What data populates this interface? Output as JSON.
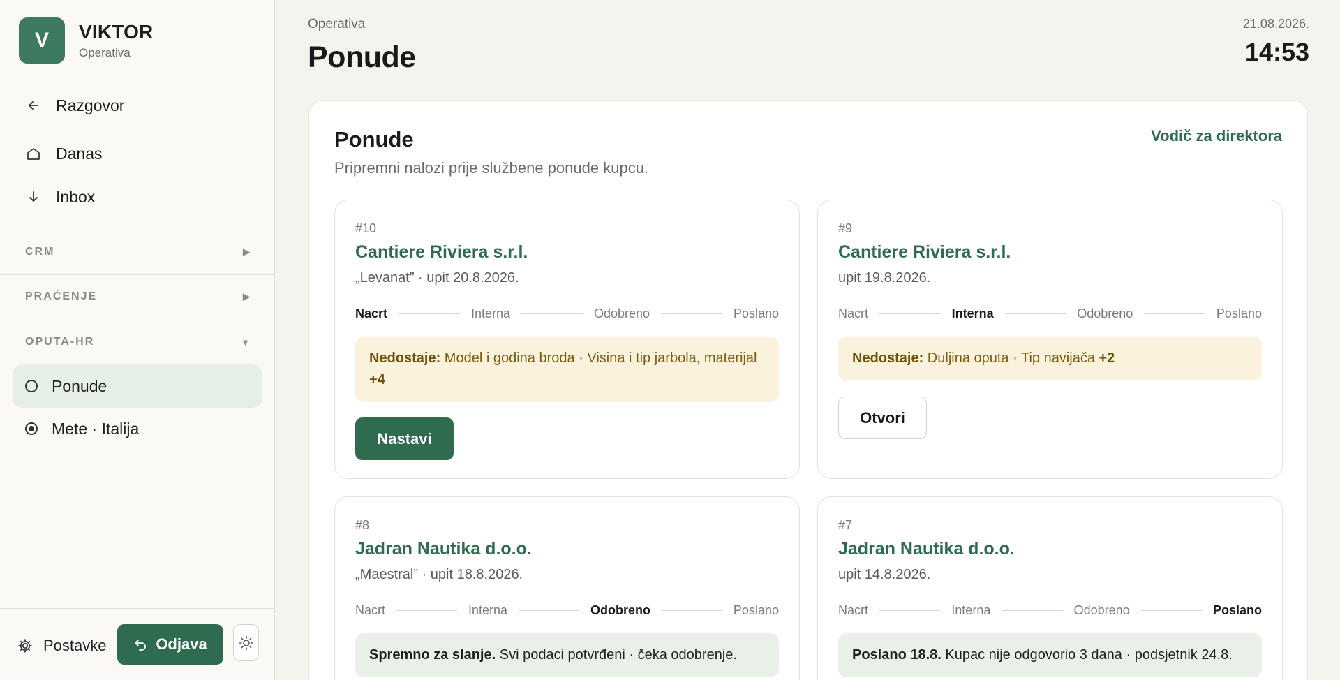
{
  "brand": {
    "initial": "V",
    "name": "VIKTOR",
    "subtitle": "Operativa"
  },
  "nav": [
    {
      "label": "Razgovor",
      "icon": "arrow-left-icon"
    },
    {
      "label": "Danas",
      "icon": "home-icon"
    },
    {
      "label": "Inbox",
      "icon": "arrow-down-icon"
    }
  ],
  "sections": [
    {
      "label": "CRM",
      "state": "collapsed",
      "arrow": "▶"
    },
    {
      "label": "PRAĆENJE",
      "state": "collapsed",
      "arrow": "▶"
    },
    {
      "label": "OPUTA-HR",
      "state": "expanded",
      "arrow": "▼"
    }
  ],
  "subnav": [
    {
      "label": "Ponude",
      "active": true
    },
    {
      "label": "Mete · Italija",
      "active": false
    }
  ],
  "footer": {
    "settings_label": "Postavke",
    "logout_label": "Odjava"
  },
  "header": {
    "breadcrumb": "Operativa",
    "title": "Ponude",
    "date": "21.08.2026.",
    "time": "14:53"
  },
  "panel": {
    "title": "Ponude",
    "subtitle": "Pripremni nalozi prije službene ponude kupcu.",
    "guide_link": "Vodič za direktora"
  },
  "steps": [
    "Nacrt",
    "Interna",
    "Odobreno",
    "Poslano"
  ],
  "cards": [
    {
      "num": "#10",
      "client": "Cantiere Riviera s.r.l.",
      "meta": "„Levanat” · upit 20.8.2026.",
      "current_step": "Nacrt",
      "note_type": "warn",
      "note_bold": "Nedostaje:",
      "note_text": " Model i godina broda · Visina i tip jarbola, materijal ",
      "note_extra": "+4",
      "action": "Nastavi",
      "action_type": "primary"
    },
    {
      "num": "#9",
      "client": "Cantiere Riviera s.r.l.",
      "meta": "upit 19.8.2026.",
      "current_step": "Interna",
      "note_type": "warn",
      "note_bold": "Nedostaje:",
      "note_text": " Duljina oputa · Tip navijača ",
      "note_extra": "+2",
      "action": "Otvori",
      "action_type": "secondary"
    },
    {
      "num": "#8",
      "client": "Jadran Nautika d.o.o.",
      "meta": "„Maestral” · upit 18.8.2026.",
      "current_step": "Odobreno",
      "note_type": "ok",
      "note_bold": "Spremno za slanje.",
      "note_text": " Svi podaci potvrđeni · čeka odobrenje.",
      "note_extra": ""
    },
    {
      "num": "#7",
      "client": "Jadran Nautika d.o.o.",
      "meta": "upit 14.8.2026.",
      "current_step": "Poslano",
      "note_type": "ok",
      "note_bold": "Poslano 18.8.",
      "note_text": " Kupac nije odgovorio 3 dana · podsjetnik 24.8.",
      "note_extra": ""
    }
  ],
  "colors": {
    "accent": "#2f6b4f",
    "avatar": "#3d7a60",
    "warn_bg": "#faf2dd",
    "ok_bg": "#e8f0e8",
    "page_bg": "#f5f3ee"
  }
}
